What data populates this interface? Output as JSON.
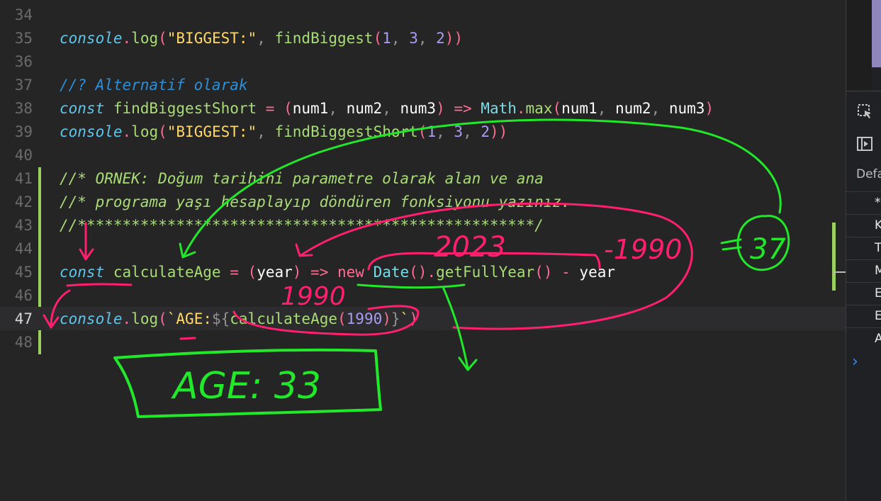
{
  "editor": {
    "lines": [
      {
        "n": "34",
        "active": false,
        "tokens": []
      },
      {
        "n": "35",
        "active": false,
        "tokens": [
          {
            "t": "console",
            "c": "t-obj"
          },
          {
            "t": ".",
            "c": "t-p"
          },
          {
            "t": "log",
            "c": "t-fn"
          },
          {
            "t": "(",
            "c": "t-p"
          },
          {
            "t": "\"BIGGEST:\"",
            "c": "t-str"
          },
          {
            "t": ", ",
            "c": "t-gray"
          },
          {
            "t": "findBiggest",
            "c": "t-fn"
          },
          {
            "t": "(",
            "c": "t-p"
          },
          {
            "t": "1",
            "c": "t-num"
          },
          {
            "t": ", ",
            "c": "t-gray"
          },
          {
            "t": "3",
            "c": "t-num"
          },
          {
            "t": ", ",
            "c": "t-gray"
          },
          {
            "t": "2",
            "c": "t-num"
          },
          {
            "t": "))",
            "c": "t-p"
          }
        ]
      },
      {
        "n": "36",
        "active": false,
        "tokens": []
      },
      {
        "n": "37",
        "active": false,
        "tokens": [
          {
            "t": "//? Alternatif olarak",
            "c": "t-cmt1"
          }
        ]
      },
      {
        "n": "38",
        "active": false,
        "tokens": [
          {
            "t": "const",
            "c": "t-ital"
          },
          {
            "t": " findBiggestShort ",
            "c": "t-fn"
          },
          {
            "t": "=",
            "c": "t-p"
          },
          {
            "t": " (",
            "c": "t-p"
          },
          {
            "t": "num1",
            "c": "t-white"
          },
          {
            "t": ", ",
            "c": "t-gray"
          },
          {
            "t": "num2",
            "c": "t-white"
          },
          {
            "t": ", ",
            "c": "t-gray"
          },
          {
            "t": "num3",
            "c": "t-white"
          },
          {
            "t": ") => ",
            "c": "t-p"
          },
          {
            "t": "Math",
            "c": "t-cls"
          },
          {
            "t": ".",
            "c": "t-p"
          },
          {
            "t": "max",
            "c": "t-fn"
          },
          {
            "t": "(",
            "c": "t-p"
          },
          {
            "t": "num1",
            "c": "t-white"
          },
          {
            "t": ", ",
            "c": "t-gray"
          },
          {
            "t": "num2",
            "c": "t-white"
          },
          {
            "t": ", ",
            "c": "t-gray"
          },
          {
            "t": "num3",
            "c": "t-white"
          },
          {
            "t": ")",
            "c": "t-p"
          }
        ]
      },
      {
        "n": "39",
        "active": false,
        "tokens": [
          {
            "t": "console",
            "c": "t-obj"
          },
          {
            "t": ".",
            "c": "t-p"
          },
          {
            "t": "log",
            "c": "t-fn"
          },
          {
            "t": "(",
            "c": "t-p"
          },
          {
            "t": "\"BIGGEST:\"",
            "c": "t-str"
          },
          {
            "t": ", ",
            "c": "t-gray"
          },
          {
            "t": "findBiggestShort",
            "c": "t-fn"
          },
          {
            "t": "(",
            "c": "t-p"
          },
          {
            "t": "1",
            "c": "t-num"
          },
          {
            "t": ", ",
            "c": "t-gray"
          },
          {
            "t": "3",
            "c": "t-num"
          },
          {
            "t": ", ",
            "c": "t-gray"
          },
          {
            "t": "2",
            "c": "t-num"
          },
          {
            "t": "))",
            "c": "t-p"
          }
        ]
      },
      {
        "n": "40",
        "active": false,
        "tokens": []
      },
      {
        "n": "41",
        "active": false,
        "tokens": [
          {
            "t": "//* ORNEK: Doğum tarihini parametre olarak alan ve ana",
            "c": "t-cmt2"
          }
        ]
      },
      {
        "n": "42",
        "active": false,
        "tokens": [
          {
            "t": "//* programa yaşı hesaplayıp döndüren fonksiyonu yazınız.",
            "c": "t-cmt2"
          }
        ]
      },
      {
        "n": "43",
        "active": false,
        "tokens": [
          {
            "t": "//***************************************************/",
            "c": "t-cmt2"
          }
        ]
      },
      {
        "n": "44",
        "active": false,
        "tokens": []
      },
      {
        "n": "45",
        "active": false,
        "tokens": [
          {
            "t": "const",
            "c": "t-ital"
          },
          {
            "t": " calculateAge ",
            "c": "t-fn"
          },
          {
            "t": "=",
            "c": "t-p"
          },
          {
            "t": " (",
            "c": "t-p"
          },
          {
            "t": "year",
            "c": "t-white"
          },
          {
            "t": ") => ",
            "c": "t-p"
          },
          {
            "t": "new",
            "c": "t-p"
          },
          {
            "t": " ",
            "c": "t-white"
          },
          {
            "t": "Date",
            "c": "t-cls"
          },
          {
            "t": "()",
            "c": "t-p"
          },
          {
            "t": ".",
            "c": "t-p"
          },
          {
            "t": "getFullYear",
            "c": "t-fn"
          },
          {
            "t": "()",
            "c": "t-p"
          },
          {
            "t": " - ",
            "c": "t-p"
          },
          {
            "t": "year",
            "c": "t-white"
          }
        ]
      },
      {
        "n": "46",
        "active": false,
        "tokens": []
      },
      {
        "n": "47",
        "active": true,
        "tokens": [
          {
            "t": "console",
            "c": "t-obj"
          },
          {
            "t": ".",
            "c": "t-p"
          },
          {
            "t": "log",
            "c": "t-fn"
          },
          {
            "t": "(",
            "c": "t-p"
          },
          {
            "t": "`AGE:",
            "c": "t-str"
          },
          {
            "t": "${",
            "c": "t-gray"
          },
          {
            "t": "calculateAge",
            "c": "t-fn"
          },
          {
            "t": "(",
            "c": "t-p"
          },
          {
            "t": "1990",
            "c": "t-num"
          },
          {
            "t": ")",
            "c": "t-p"
          },
          {
            "t": "}",
            "c": "t-gray"
          },
          {
            "t": "`",
            "c": "t-str"
          },
          {
            "t": ")",
            "c": "t-p"
          }
        ]
      },
      {
        "n": "48",
        "active": false,
        "tokens": []
      }
    ]
  },
  "annotations": {
    "note_2023": "2023",
    "note_minus1990": "-1990",
    "note_37": "37",
    "note_1990": "1990",
    "note_age_result": "AGE: 33",
    "colors": {
      "pink": "#ff1f6e",
      "green": "#22e82a"
    }
  },
  "devtools": {
    "default_label": "Defa",
    "rows": [
      "*",
      "K",
      "T",
      "M",
      "E",
      "E",
      "A"
    ],
    "expand_icon": "chevron-right-icon"
  }
}
